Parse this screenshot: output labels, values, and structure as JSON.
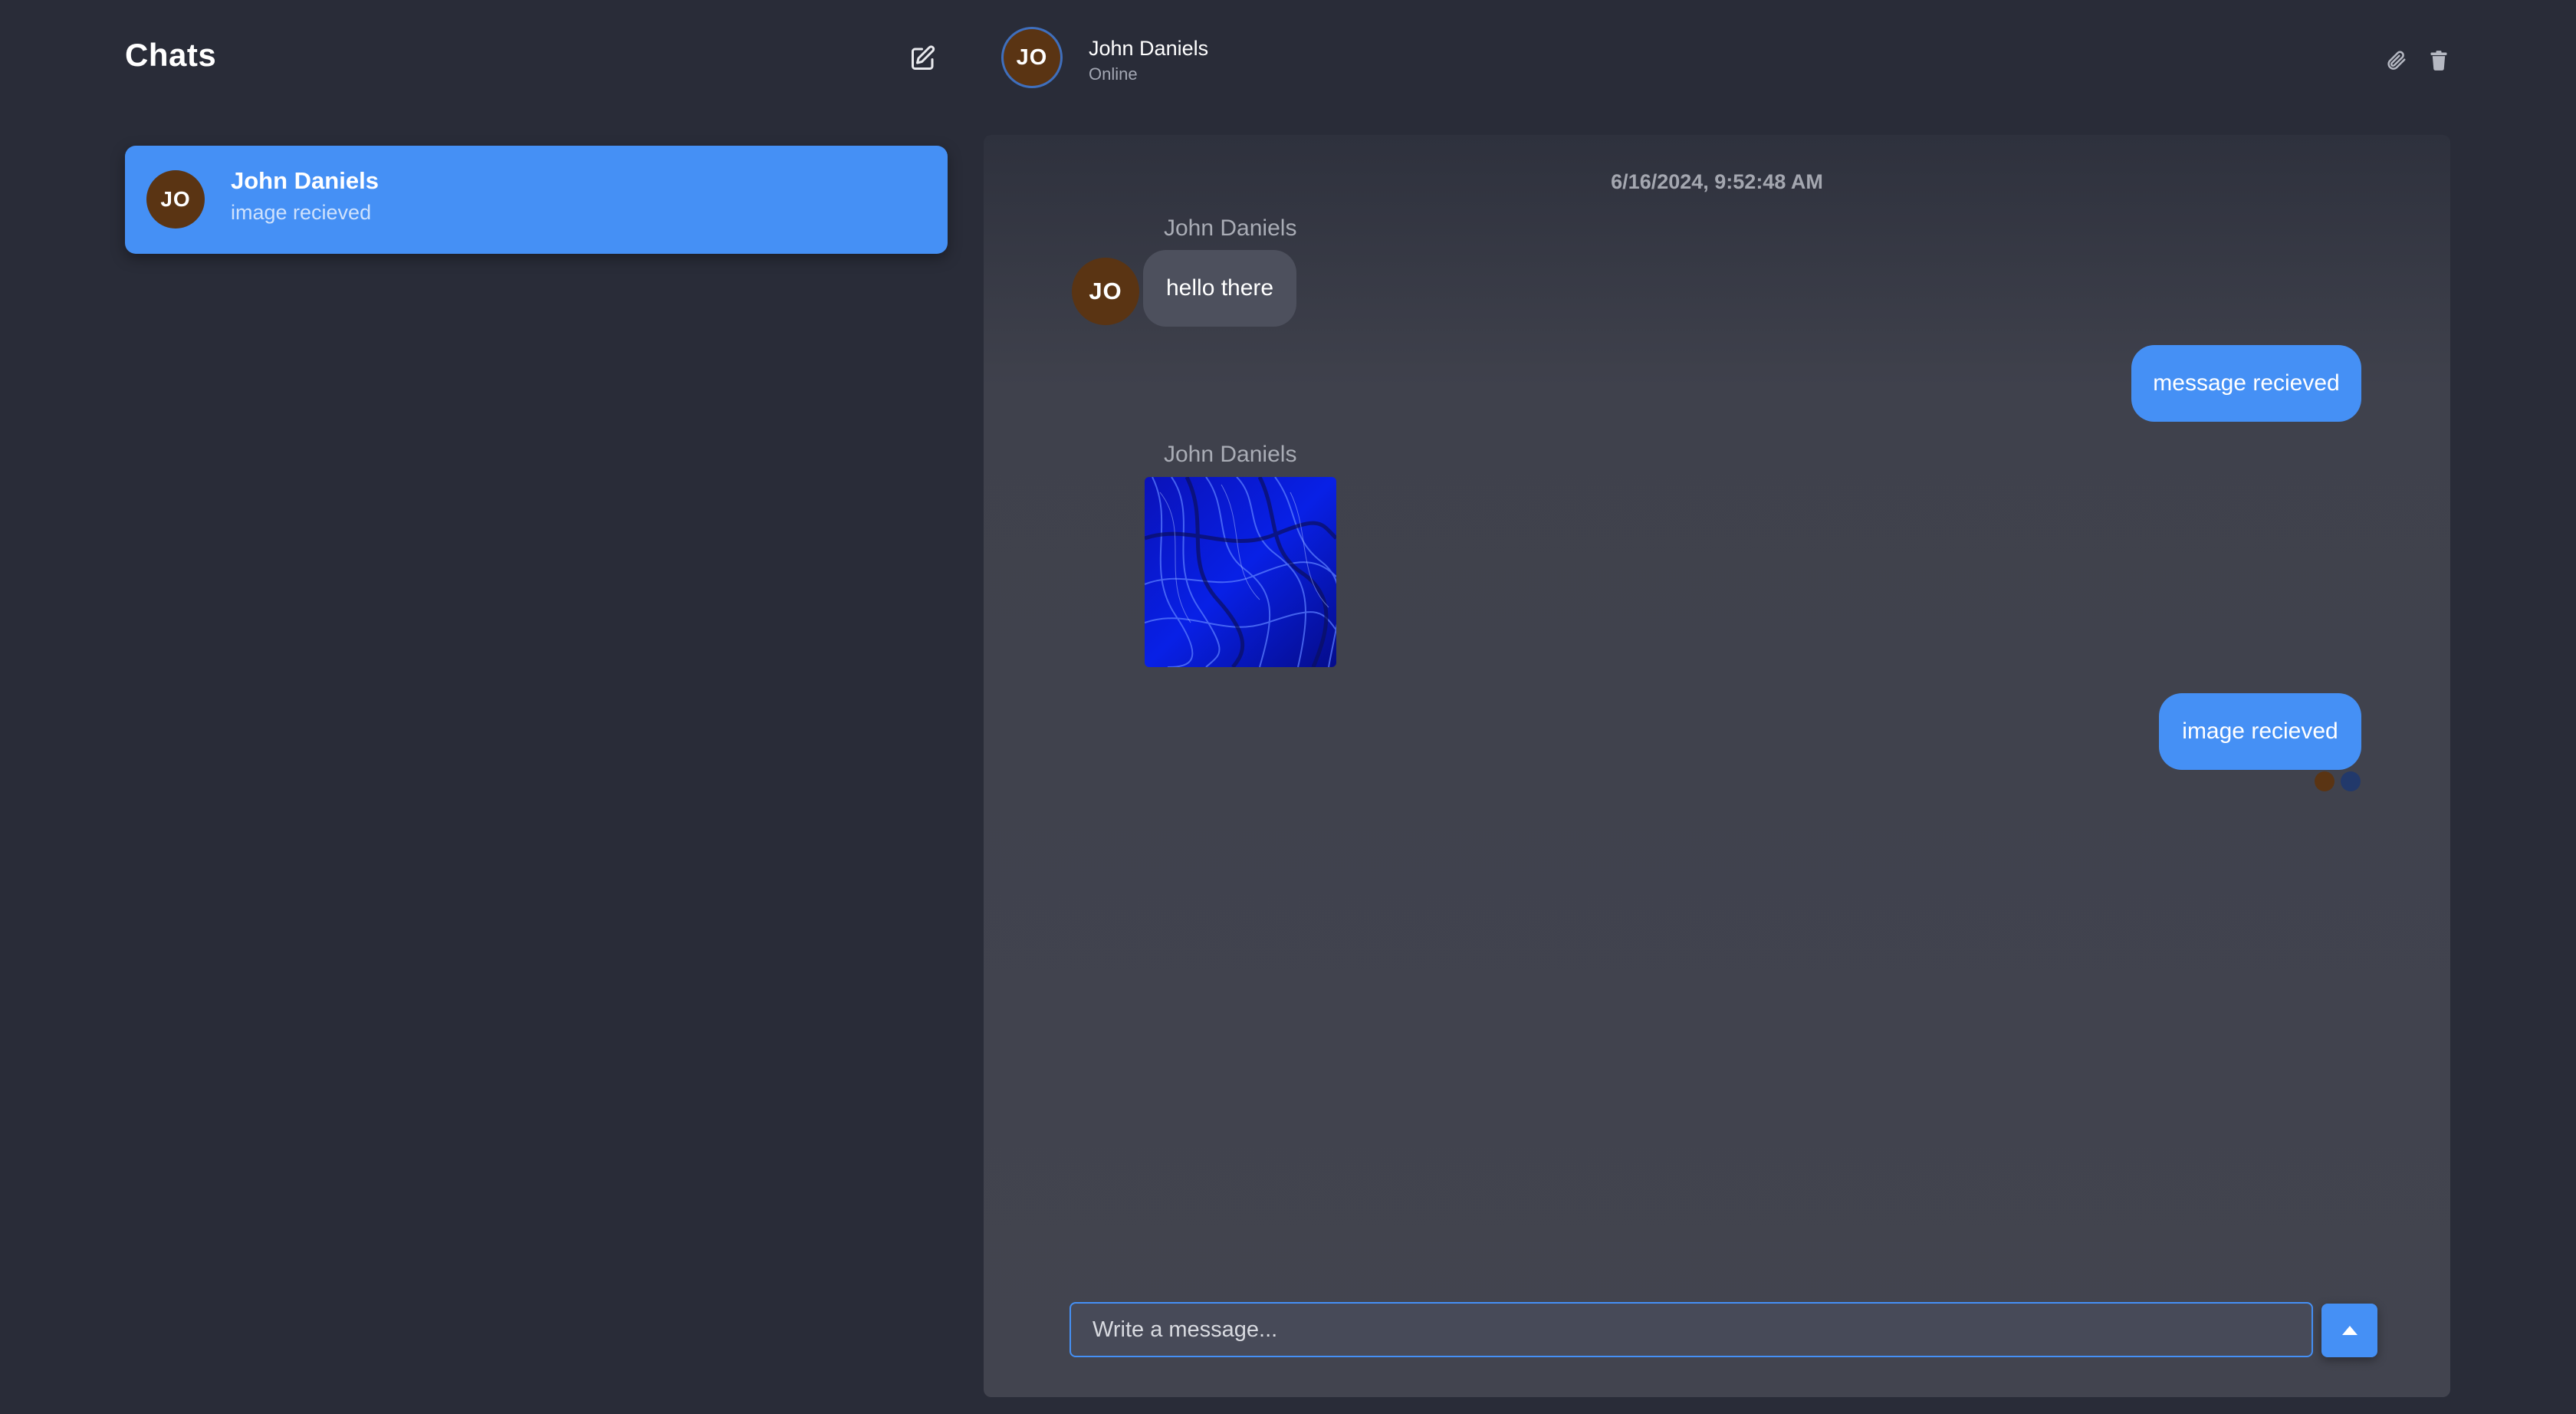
{
  "sidebar": {
    "title": "Chats",
    "compose_icon": "compose-icon",
    "chats": [
      {
        "initials": "JO",
        "name": "John Daniels",
        "preview": "image recieved",
        "selected": true
      }
    ]
  },
  "header": {
    "initials": "JO",
    "name": "John Daniels",
    "status": "Online",
    "attach_icon": "paperclip-icon",
    "delete_icon": "trash-icon"
  },
  "conversation": {
    "date": "6/16/2024, 9:52:48 AM",
    "messages": [
      {
        "direction": "incoming",
        "sender": "John Daniels",
        "initials": "JO",
        "text": "hello there"
      },
      {
        "direction": "outgoing",
        "text": "message recieved"
      },
      {
        "direction": "incoming",
        "sender": "John Daniels",
        "type": "image",
        "image": "blue-abstract-swirl"
      },
      {
        "direction": "outgoing",
        "text": "image recieved"
      }
    ]
  },
  "composer": {
    "placeholder": "Write a message...",
    "value": "",
    "send_icon": "triangle-up-icon"
  },
  "colors": {
    "background": "#292c38",
    "accent": "#4590f5",
    "avatar": "#5a3413",
    "bubble_incoming": "#4d505d"
  }
}
